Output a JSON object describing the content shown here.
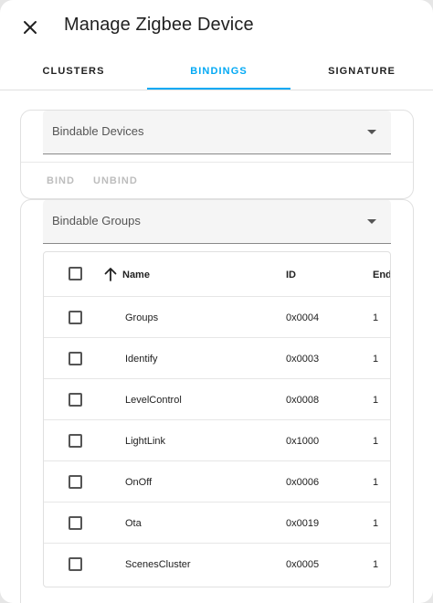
{
  "dialog": {
    "title": "Manage Zigbee Device",
    "close_icon": "close-icon"
  },
  "tabs": [
    {
      "label": "CLUSTERS",
      "active": false
    },
    {
      "label": "BINDINGS",
      "active": true
    },
    {
      "label": "SIGNATURE",
      "active": false
    }
  ],
  "colors": {
    "accent": "#03a9f4",
    "disabled": "#bdbdbd"
  },
  "bindable_devices": {
    "label": "Bindable Devices",
    "actions": {
      "bind": "BIND",
      "unbind": "UNBIND"
    }
  },
  "bindable_groups": {
    "label": "Bindable Groups"
  },
  "table": {
    "columns": {
      "name": "Name",
      "id": "ID",
      "endpoint": "End…"
    },
    "sort_icon": "arrow-up-icon",
    "rows": [
      {
        "name": "Groups",
        "id": "0x0004",
        "endpoint": "1"
      },
      {
        "name": "Identify",
        "id": "0x0003",
        "endpoint": "1"
      },
      {
        "name": "LevelControl",
        "id": "0x0008",
        "endpoint": "1"
      },
      {
        "name": "LightLink",
        "id": "0x1000",
        "endpoint": "1"
      },
      {
        "name": "OnOff",
        "id": "0x0006",
        "endpoint": "1"
      },
      {
        "name": "Ota",
        "id": "0x0019",
        "endpoint": "1"
      },
      {
        "name": "ScenesCluster",
        "id": "0x0005",
        "endpoint": "1"
      }
    ]
  }
}
